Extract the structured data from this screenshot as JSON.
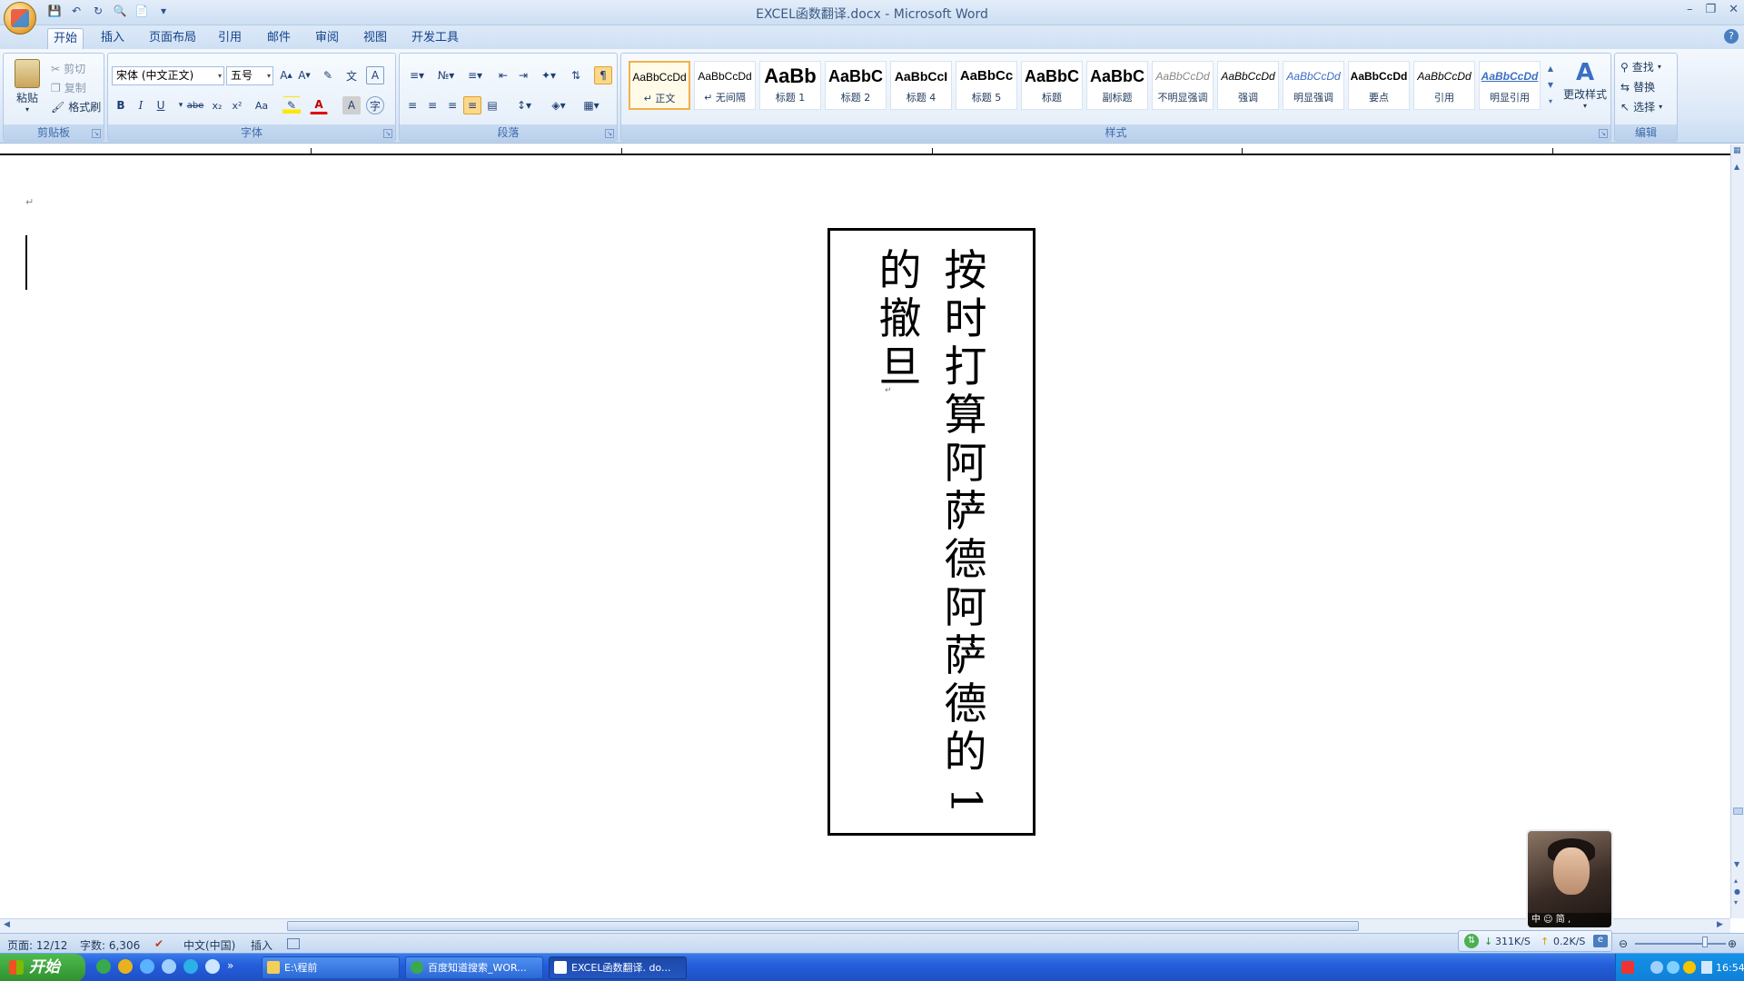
{
  "window": {
    "title": "EXCEL函数翻译.docx - Microsoft Word"
  },
  "qat": {
    "icons": [
      "save-icon",
      "undo-icon",
      "redo-icon",
      "print-preview-icon",
      "new-document-icon",
      "customize-icon"
    ]
  },
  "tabs": [
    "开始",
    "插入",
    "页面布局",
    "引用",
    "邮件",
    "审阅",
    "视图",
    "开发工具"
  ],
  "active_tab": "开始",
  "clipboard": {
    "paste": "粘贴",
    "cut": "剪切",
    "copy": "复制",
    "format_painter": "格式刷",
    "label": "剪贴板"
  },
  "font": {
    "name": "宋体 (中文正文)",
    "size": "五号",
    "label": "字体",
    "buttons": [
      "B",
      "I",
      "U",
      "abe",
      "x₂",
      "x²",
      "Aa",
      "A"
    ]
  },
  "paragraph": {
    "label": "段落"
  },
  "styles": {
    "label": "样式",
    "change_styles": "更改样式",
    "items": [
      {
        "sample": "AaBbCcDd",
        "name": "↵ 正文"
      },
      {
        "sample": "AaBbCcDd",
        "name": "↵ 无间隔"
      },
      {
        "sample": "AaBb",
        "name": "标题 1"
      },
      {
        "sample": "AaBbC",
        "name": "标题 2"
      },
      {
        "sample": "AaBbCcI",
        "name": "标题 4"
      },
      {
        "sample": "AaBbCc",
        "name": "标题 5"
      },
      {
        "sample": "AaBbC",
        "name": "标题"
      },
      {
        "sample": "AaBbC",
        "name": "副标题"
      },
      {
        "sample": "AaBbCcDd",
        "name": "不明显强调"
      },
      {
        "sample": "AaBbCcDd",
        "name": "强调"
      },
      {
        "sample": "AaBbCcDd",
        "name": "明显强调"
      },
      {
        "sample": "AaBbCcDd",
        "name": "要点"
      },
      {
        "sample": "AaBbCcDd",
        "name": "引用"
      },
      {
        "sample": "AaBbCcDd",
        "name": "明显引用"
      }
    ]
  },
  "editing": {
    "label": "编辑",
    "find": "查找",
    "replace": "替换",
    "select": "选择"
  },
  "document": {
    "para_mark": "↵",
    "textbox_col1": "按时打算阿萨德阿萨德的",
    "textbox_col1_last": "1",
    "textbox_col2": "的撤旦",
    "textbox_end_mark": "↵"
  },
  "status": {
    "page": "页面: 12/12",
    "words": "字数: 6,306",
    "language": "中文(中国)",
    "mode": "插入"
  },
  "net": {
    "down": "311K/S",
    "up": "0.2K/S"
  },
  "avatar": {
    "badge": "中 ☺ 简 ,"
  },
  "taskbar": {
    "start": "开始",
    "buttons": [
      {
        "label": "E:\\程前"
      },
      {
        "label": "百度知道搜索_WOR..."
      },
      {
        "label": "EXCEL函数翻译. do..."
      }
    ],
    "clock": "16:54"
  },
  "colors": {
    "ribbon": "#dbe8f7",
    "accent": "#f2b14a",
    "taskbar": "#245edb",
    "start": "#2f8f2f"
  }
}
